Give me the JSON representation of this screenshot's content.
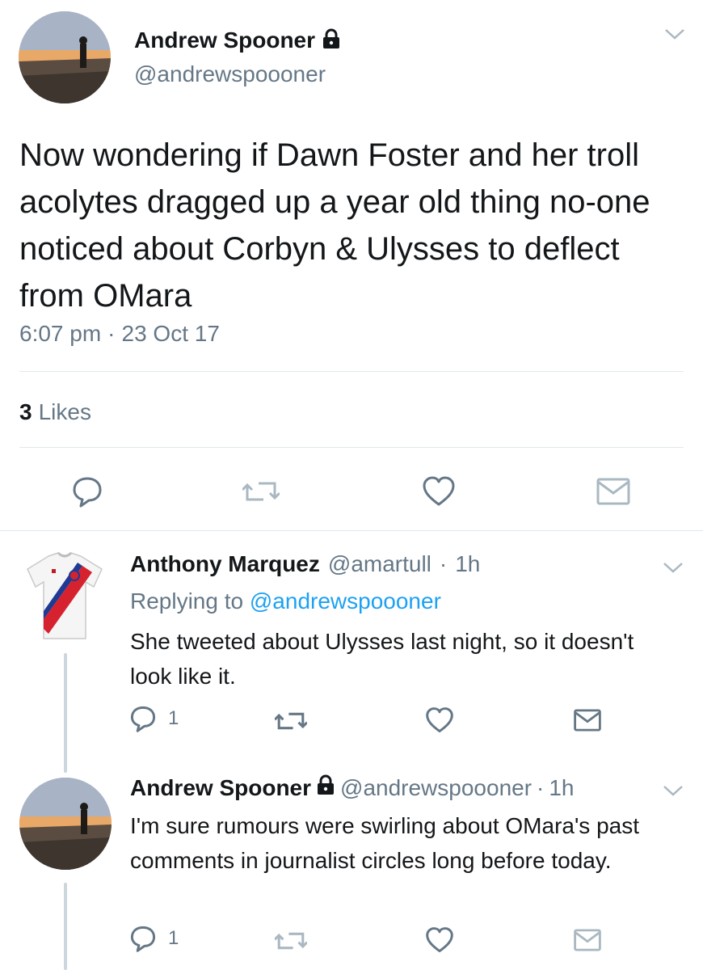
{
  "main_tweet": {
    "author_name": "Andrew Spooner",
    "author_handle": "@andrewspoooner",
    "text": "Now wondering if Dawn Foster and her troll acolytes dragged up a year old thing no-one noticed about Corbyn & Ulysses to deflect from OMara",
    "time": "6:07 pm",
    "separator": "·",
    "date": "23 Oct 17",
    "likes_count": "3",
    "likes_label": "Likes"
  },
  "replies": [
    {
      "author_name": "Anthony Marquez",
      "author_handle": "@amartull",
      "age": "1h",
      "separator": "·",
      "replying_prefix": "Replying to",
      "replying_handle": "@andrewspoooner",
      "text": "She tweeted about Ulysses last night, so it doesn't look like it.",
      "reply_count": "1"
    },
    {
      "author_name": "Andrew Spooner",
      "author_handle": "@andrewspoooner",
      "age": "1h",
      "separator": "·",
      "text": "I'm sure rumours were swirling about OMara's past comments in journalist circles long before today.",
      "reply_count": "1"
    }
  ],
  "icons": {
    "colors": {
      "icon_gray": "#657786",
      "link_blue": "#1da1f2",
      "divider": "#e1e8ed"
    }
  }
}
